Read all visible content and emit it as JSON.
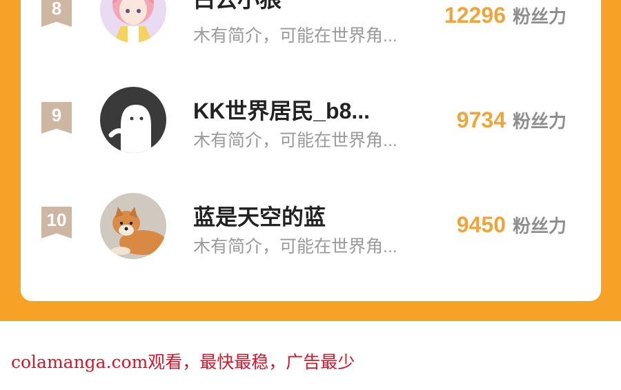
{
  "ranking": {
    "rows": [
      {
        "rank": "8",
        "name": "白云小狼",
        "desc": "木有简介，可能在世界角...",
        "fans": "12296",
        "unit": "粉丝力",
        "avatar": "anime-girl-avatar"
      },
      {
        "rank": "9",
        "name": "KK世界居民_b8...",
        "desc": "木有简介，可能在世界角...",
        "fans": "9734",
        "unit": "粉丝力",
        "avatar": "default-user-avatar"
      },
      {
        "rank": "10",
        "name": "蓝是天空的蓝",
        "desc": "木有简介，可能在世界角...",
        "fans": "9450",
        "unit": "粉丝力",
        "avatar": "shiba-dog-avatar"
      }
    ]
  },
  "footer": {
    "text": "colamanga.com观看，最快最稳，广告最少"
  },
  "colors": {
    "background": "#f8a127",
    "card": "#ffffff",
    "rank_badge": "#cdb7a2",
    "fans_number": "#f0a53a",
    "footer_text": "#d0182d"
  }
}
